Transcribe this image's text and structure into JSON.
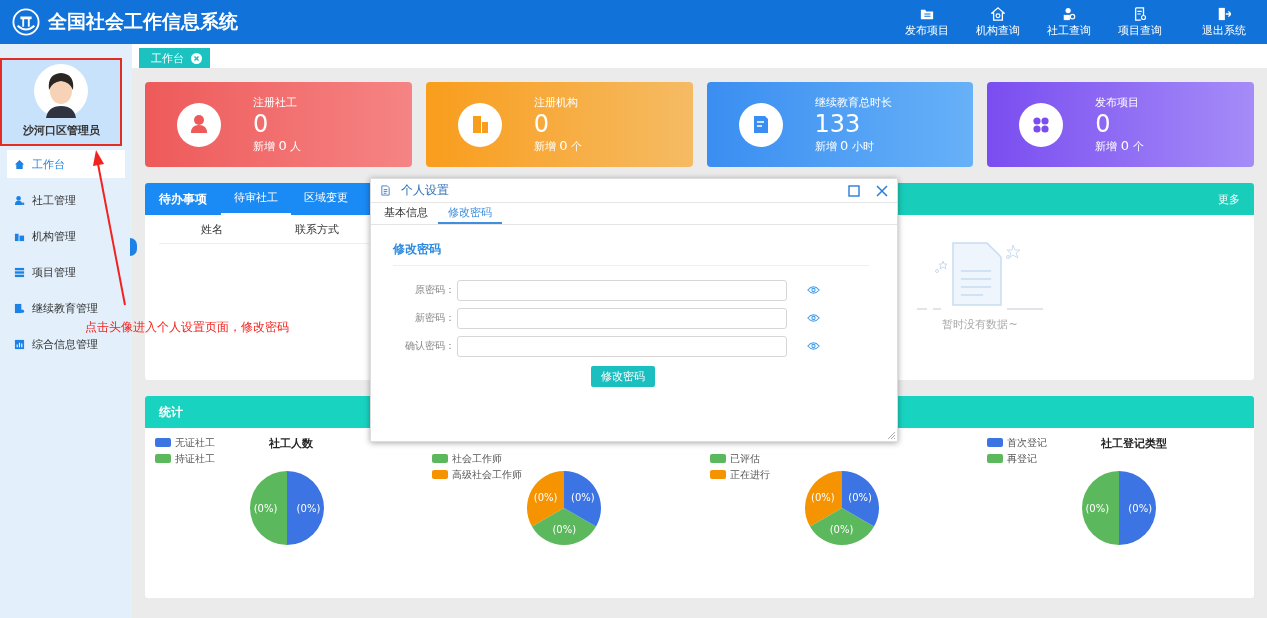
{
  "header": {
    "title": "全国社会工作信息系统",
    "actions": [
      {
        "label": "发布项目"
      },
      {
        "label": "机构查询"
      },
      {
        "label": "社工查询"
      },
      {
        "label": "项目查询"
      },
      {
        "label": "退出系统"
      }
    ]
  },
  "sidebar": {
    "user": {
      "name": "沙河口区管理员"
    },
    "items": [
      {
        "label": "工作台",
        "selected": true
      },
      {
        "label": "社工管理",
        "selected": false
      },
      {
        "label": "机构管理",
        "selected": false
      },
      {
        "label": "项目管理",
        "selected": false
      },
      {
        "label": "继续教育管理",
        "selected": false
      },
      {
        "label": "综合信息管理",
        "selected": false
      }
    ]
  },
  "tabs": [
    {
      "label": "工作台",
      "selected": true
    }
  ],
  "cards": [
    {
      "label": "注册社工",
      "value": "0",
      "sub_prefix": "新增",
      "sub_value": "0",
      "sub_unit": "人"
    },
    {
      "label": "注册机构",
      "value": "0",
      "sub_prefix": "新增",
      "sub_value": "0",
      "sub_unit": "个"
    },
    {
      "label": "继续教育总时长",
      "value": "133",
      "sub_prefix": "新增",
      "sub_value": "0",
      "sub_unit": "小时"
    },
    {
      "label": "发布项目",
      "value": "0",
      "sub_prefix": "新增",
      "sub_value": "0",
      "sub_unit": "个"
    }
  ],
  "todo": {
    "title": "待办事项",
    "tabs": [
      {
        "label": "待审社工",
        "selected": true
      },
      {
        "label": "区域变更",
        "selected": false
      }
    ],
    "columns": [
      "姓名",
      "联系方式"
    ],
    "more": "更多",
    "empty_text": "暂时没有数据~"
  },
  "stats": {
    "title": "统计",
    "charts": [
      {
        "title": "社工人数",
        "legend": [
          {
            "label": "无证社工",
            "color": "#3c74e3"
          },
          {
            "label": "持证社工",
            "color": "#5cb85c"
          }
        ],
        "slices": [
          {
            "label": "(0%)",
            "color": "#5cb85c"
          },
          {
            "label": "(0%)",
            "color": "#3c74e3"
          }
        ]
      },
      {
        "legend": [
          {
            "label": "社会工作师",
            "color": "#5cb85c"
          },
          {
            "label": "高级社会工作师",
            "color": "#f59300"
          }
        ],
        "slices": [
          {
            "label": "(0%)",
            "color": "#f59300"
          },
          {
            "label": "(0%)",
            "color": "#5cb85c"
          },
          {
            "label": "(0%)",
            "color": "#3c74e3"
          }
        ]
      },
      {
        "legend": [
          {
            "label": "已评估",
            "color": "#5cb85c"
          },
          {
            "label": "正在进行",
            "color": "#f59300"
          }
        ],
        "slices": [
          {
            "label": "(0%)",
            "color": "#f59300"
          },
          {
            "label": "(0%)",
            "color": "#5cb85c"
          },
          {
            "label": "(0%)",
            "color": "#3c74e3"
          }
        ]
      },
      {
        "title": "社工登记类型",
        "legend": [
          {
            "label": "首次登记",
            "color": "#3c74e3"
          },
          {
            "label": "再登记",
            "color": "#5cb85c"
          }
        ],
        "slices": [
          {
            "label": "(0%)",
            "color": "#5cb85c"
          },
          {
            "label": "(0%)",
            "color": "#3c74e3"
          }
        ]
      }
    ]
  },
  "modal": {
    "title": "个人设置",
    "tabs": [
      {
        "label": "基本信息",
        "selected": false
      },
      {
        "label": "修改密码",
        "selected": true
      }
    ],
    "section_title": "修改密码",
    "fields": [
      {
        "label": "原密码："
      },
      {
        "label": "新密码："
      },
      {
        "label": "确认密码："
      }
    ],
    "submit": "修改密码"
  },
  "annotation": {
    "text": "点击头像进入个人设置页面，修改密码"
  }
}
